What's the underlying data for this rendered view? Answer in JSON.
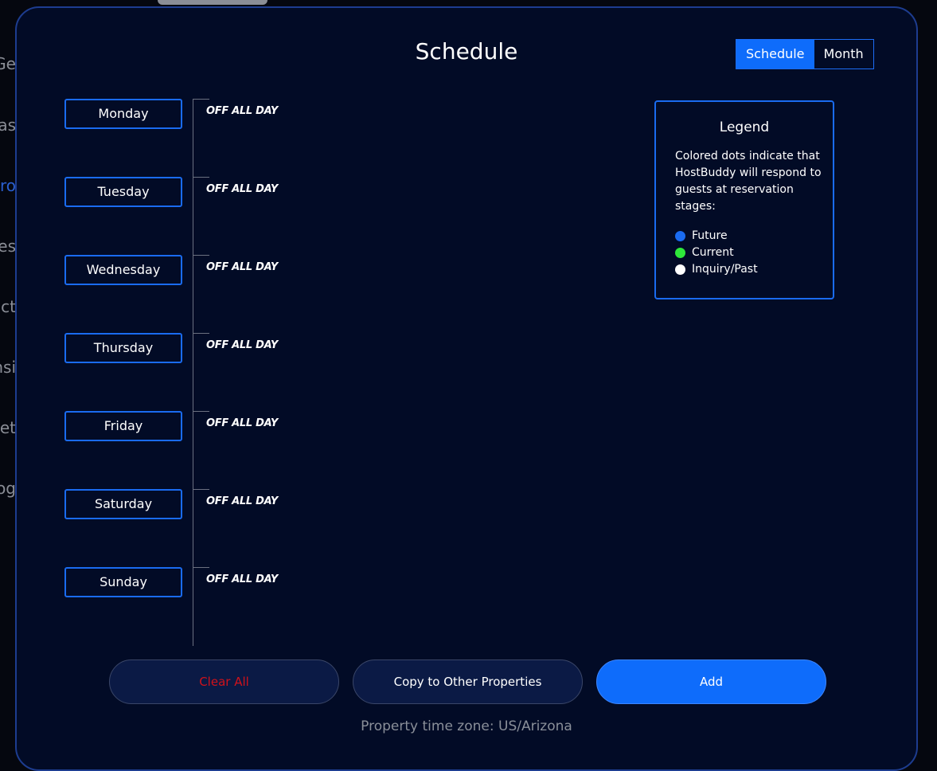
{
  "background_sidebar_fragments": [
    "Ge",
    "as",
    "ro",
    "les",
    "ct",
    "nsi",
    "et",
    "og"
  ],
  "modal": {
    "title": "Schedule",
    "view_toggle": {
      "options": [
        "Schedule",
        "Month"
      ],
      "selected": "Schedule"
    },
    "days": [
      {
        "label": "Monday",
        "status": "OFF ALL DAY"
      },
      {
        "label": "Tuesday",
        "status": "OFF ALL DAY"
      },
      {
        "label": "Wednesday",
        "status": "OFF ALL DAY"
      },
      {
        "label": "Thursday",
        "status": "OFF ALL DAY"
      },
      {
        "label": "Friday",
        "status": "OFF ALL DAY"
      },
      {
        "label": "Saturday",
        "status": "OFF ALL DAY"
      },
      {
        "label": "Sunday",
        "status": "OFF ALL DAY"
      }
    ],
    "legend": {
      "title": "Legend",
      "description": "Colored dots indicate that HostBuddy will respond to guests at reservation stages:",
      "items": [
        {
          "label": "Future",
          "color": "#1a6bf0"
        },
        {
          "label": "Current",
          "color": "#2ee83a"
        },
        {
          "label": "Inquiry/Past",
          "color": "#ffffff"
        }
      ]
    },
    "buttons": {
      "clear_all": "Clear All",
      "copy": "Copy to Other Properties",
      "add": "Add"
    },
    "clear_color": "#d0121b",
    "timezone": "Property time zone: US/Arizona"
  }
}
